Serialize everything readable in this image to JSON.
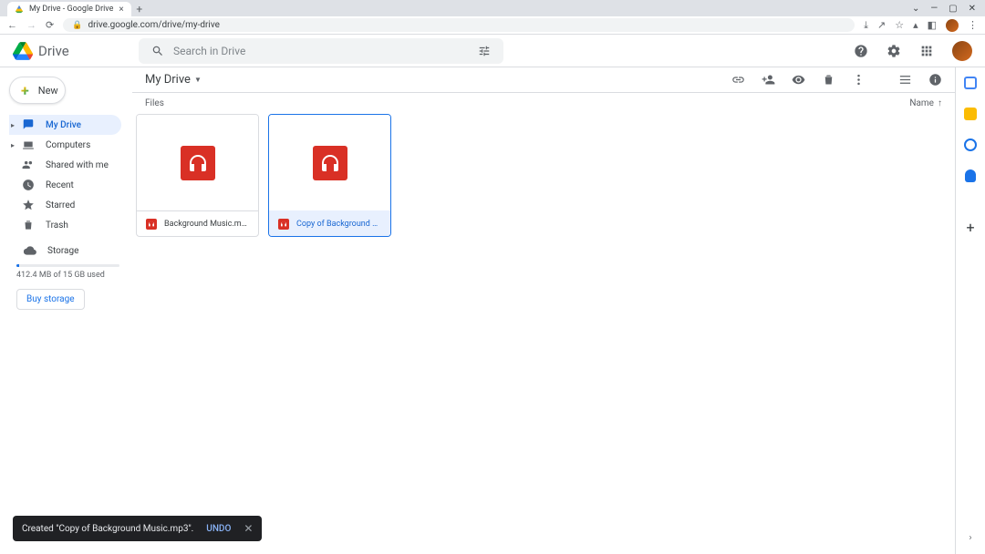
{
  "browser": {
    "tab_title": "My Drive - Google Drive",
    "url": "drive.google.com/drive/my-drive"
  },
  "header": {
    "product_name": "Drive",
    "search_placeholder": "Search in Drive"
  },
  "sidebar": {
    "new_label": "New",
    "items": [
      {
        "label": "My Drive"
      },
      {
        "label": "Computers"
      },
      {
        "label": "Shared with me"
      },
      {
        "label": "Recent"
      },
      {
        "label": "Starred"
      },
      {
        "label": "Trash"
      }
    ],
    "storage_label": "Storage",
    "storage_usage": "412.4 MB of 15 GB used",
    "buy_storage": "Buy storage"
  },
  "content": {
    "breadcrumb": "My Drive",
    "files_heading": "Files",
    "sort_column": "Name",
    "files": [
      {
        "name": "Background Music.mp3",
        "selected": false
      },
      {
        "name": "Copy of Background Music....",
        "selected": true
      }
    ]
  },
  "toast": {
    "message": "Created \"Copy of Background Music.mp3\".",
    "undo_label": "UNDO"
  }
}
